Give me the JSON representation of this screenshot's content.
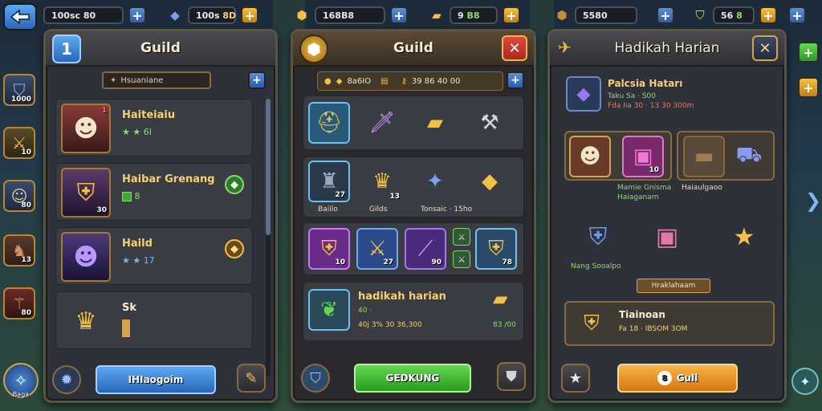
{
  "nav": {
    "back_icon": "back-arrow-icon"
  },
  "topbar1": {
    "amount1": "100sc 80",
    "amount2": "100s",
    "amount2b": "8D"
  },
  "topbar2": {
    "amount1": "168B8",
    "amount2": "9",
    "amount2b": "B8"
  },
  "topbar3": {
    "amount1": "5580",
    "amount2": "56",
    "amount2b": "8"
  },
  "side_slots": [
    {
      "icon": "shield-icon",
      "count": "1000"
    },
    {
      "icon": "sword-icon",
      "count": "10"
    },
    {
      "icon": "hero-icon",
      "count": "80"
    },
    {
      "icon": "beast-icon",
      "count": "13"
    },
    {
      "icon": "staff-icon",
      "count": "80"
    },
    {
      "icon": "compass-icon",
      "count": "Baga"
    }
  ],
  "panel1": {
    "badge": "1",
    "title": "Guild",
    "search_value": "Hsuaniane",
    "rows": [
      {
        "name": "Haiteiaiu",
        "stats": "★ ★ 6I",
        "num": "1"
      },
      {
        "name": "Haibar Grenang",
        "stats": "8",
        "num": "30"
      },
      {
        "name": "Haild",
        "stats": "★ ★ 17",
        "num": ""
      },
      {
        "name": "Sk",
        "stats": "",
        "num": ""
      }
    ],
    "action_button": "IHIaogoim"
  },
  "panel2": {
    "title": "Guild",
    "bar_text": "8a6IO",
    "bar_text2": "39 86 40 00",
    "row2_labels": [
      "Baiilo",
      "Gilds",
      "Tonsaic · 15ho"
    ],
    "row2_counts": [
      "27",
      "13"
    ],
    "row3_counts": [
      "10",
      "27",
      "90",
      "78"
    ],
    "promo": {
      "title": "hadikah harian",
      "line1": "40 ·",
      "line2": "40j 3% 30 36,300",
      "reward": "83 /00"
    },
    "action_button": "GEDKUNG"
  },
  "panel3": {
    "title": "Hadikah Harian",
    "card": {
      "title": "Palcsia Hatarı",
      "line1": "Taku Sa · S00",
      "line2": "Fda Iia 30 · 13 30 300m"
    },
    "labels": [
      "Mamie Gnisma",
      "Haiaganam",
      "Haiaulgaoo",
      "Nang Sooalpo"
    ],
    "count": "10",
    "chip": "Hraklahaam",
    "bottom_card": {
      "title": "Tiainoan",
      "line": "Fa 18 · IBSOM 3OM"
    },
    "action_button": "Gull",
    "action_prefix": "8"
  },
  "colors": {
    "gold": "#f4d072",
    "green": "#8fd86a",
    "accent_blue": "#5ca8f0"
  }
}
